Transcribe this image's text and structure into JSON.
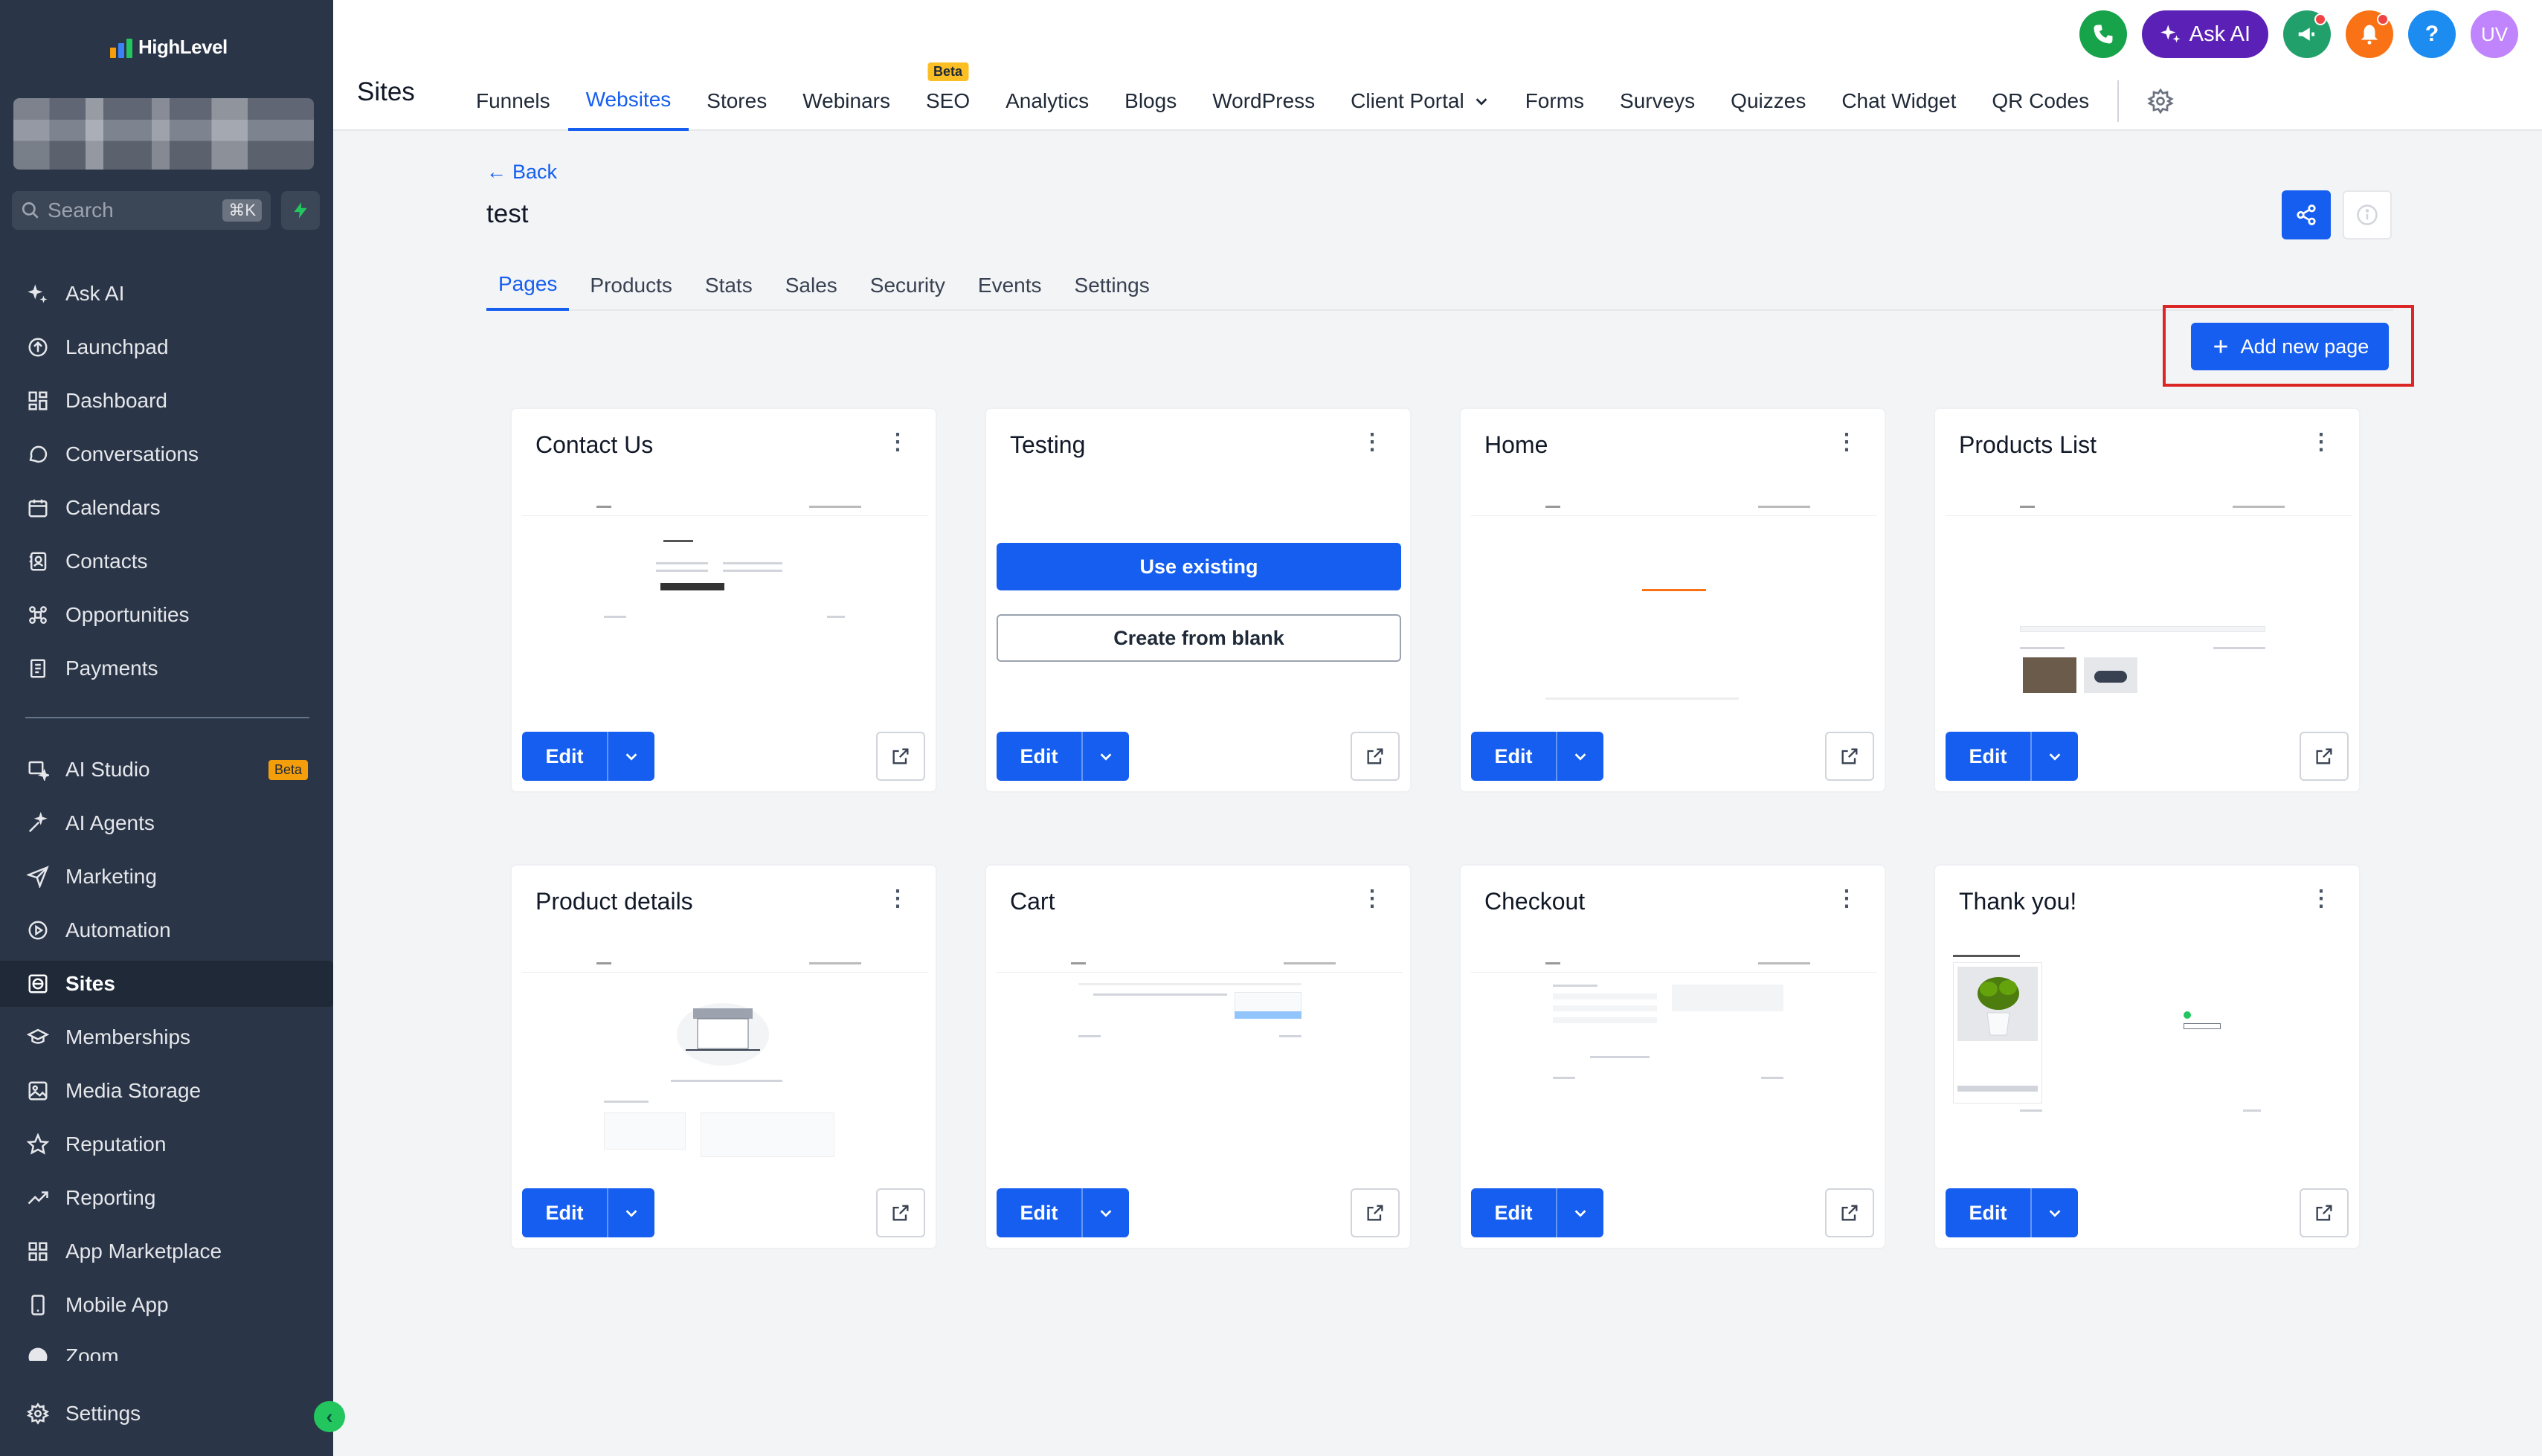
{
  "brand": {
    "name": "HighLevel"
  },
  "sidebar": {
    "search_placeholder": "Search",
    "search_shortcut": "⌘K",
    "items": [
      {
        "label": "Ask AI",
        "icon": "sparkle-icon"
      },
      {
        "label": "Launchpad",
        "icon": "rocket-icon"
      },
      {
        "label": "Dashboard",
        "icon": "dashboard-icon"
      },
      {
        "label": "Conversations",
        "icon": "chat-icon"
      },
      {
        "label": "Calendars",
        "icon": "calendar-icon"
      },
      {
        "label": "Contacts",
        "icon": "contacts-icon"
      },
      {
        "label": "Opportunities",
        "icon": "opportunities-icon"
      },
      {
        "label": "Payments",
        "icon": "payments-icon"
      }
    ],
    "items2": [
      {
        "label": "AI Studio",
        "icon": "ai-studio-icon",
        "badge": "Beta"
      },
      {
        "label": "AI Agents",
        "icon": "ai-agents-icon"
      },
      {
        "label": "Marketing",
        "icon": "send-icon"
      },
      {
        "label": "Automation",
        "icon": "automation-icon"
      },
      {
        "label": "Sites",
        "icon": "globe-icon",
        "active": true
      },
      {
        "label": "Memberships",
        "icon": "memberships-icon"
      },
      {
        "label": "Media Storage",
        "icon": "image-icon"
      },
      {
        "label": "Reputation",
        "icon": "star-icon"
      },
      {
        "label": "Reporting",
        "icon": "trend-icon"
      },
      {
        "label": "App Marketplace",
        "icon": "grid-icon"
      },
      {
        "label": "Mobile App",
        "icon": "phone-icon"
      },
      {
        "label": "Zoom",
        "icon": "zoom-icon"
      }
    ],
    "settings_label": "Settings"
  },
  "header": {
    "title": "Sites",
    "tabs": [
      {
        "label": "Funnels"
      },
      {
        "label": "Websites",
        "active": true
      },
      {
        "label": "Stores"
      },
      {
        "label": "Webinars"
      },
      {
        "label": "SEO",
        "badge": "Beta"
      },
      {
        "label": "Analytics"
      },
      {
        "label": "Blogs"
      },
      {
        "label": "WordPress"
      },
      {
        "label": "Client Portal",
        "dropdown": true
      },
      {
        "label": "Forms"
      },
      {
        "label": "Surveys"
      },
      {
        "label": "Quizzes"
      },
      {
        "label": "Chat Widget"
      },
      {
        "label": "QR Codes"
      }
    ],
    "ask_ai_label": "Ask AI",
    "help_label": "?",
    "avatar_initials": "UV"
  },
  "content": {
    "back_label": "Back",
    "site_name": "test",
    "subtabs": [
      {
        "label": "Pages",
        "active": true
      },
      {
        "label": "Products"
      },
      {
        "label": "Stats"
      },
      {
        "label": "Sales"
      },
      {
        "label": "Security"
      },
      {
        "label": "Events"
      },
      {
        "label": "Settings"
      }
    ],
    "add_page_label": "Add new page"
  },
  "cards": [
    {
      "title": "Contact Us",
      "preview": "contact"
    },
    {
      "title": "Testing",
      "preview": "empty",
      "use_existing_label": "Use existing",
      "create_blank_label": "Create from blank"
    },
    {
      "title": "Home",
      "preview": "home"
    },
    {
      "title": "Products List",
      "preview": "products"
    },
    {
      "title": "Product details",
      "preview": "details"
    },
    {
      "title": "Cart",
      "preview": "cart"
    },
    {
      "title": "Checkout",
      "preview": "checkout"
    },
    {
      "title": "Thank you!",
      "preview": "thankyou"
    }
  ],
  "card_edit_label": "Edit",
  "colors": {
    "primary": "#155eef",
    "sidebar_bg": "#2a3547",
    "highlight_border": "#dc2626"
  }
}
